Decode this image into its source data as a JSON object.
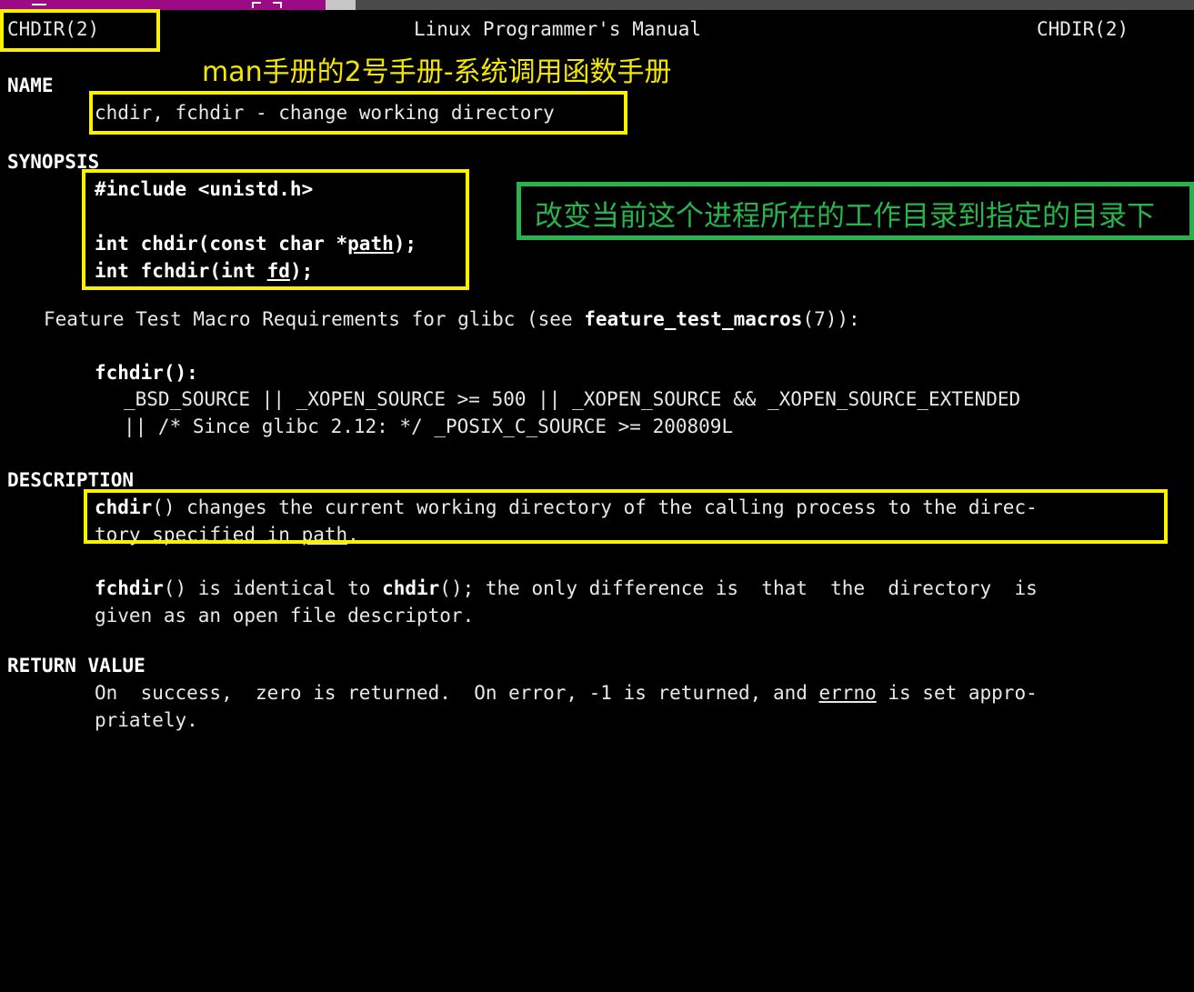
{
  "window": {
    "titlebar_magenta": "#9c0a86",
    "titlebar_dark": "#4a4a4a",
    "titlebar_tab": "#c6c6c6"
  },
  "annotation_colors": {
    "yellow": "#fbf000",
    "green": "#28b44c"
  },
  "manpage": {
    "header_left": "CHDIR(2)",
    "header_center": "Linux Programmer's Manual",
    "header_right": "CHDIR(2)",
    "sections": {
      "name_heading": "NAME",
      "name_body": "chdir, fchdir - change working directory",
      "synopsis_heading": "SYNOPSIS",
      "synopsis_include": "#include <unistd.h>",
      "synopsis_proto1_pre": "int chdir(const char *",
      "synopsis_proto1_arg": "path",
      "synopsis_proto1_post": ");",
      "synopsis_proto2_pre": "int fchdir(int ",
      "synopsis_proto2_arg": "fd",
      "synopsis_proto2_post": ");",
      "ftm_line_pre": "Feature Test Macro Requirements for glibc (see ",
      "ftm_line_bold": "feature_test_macros",
      "ftm_line_post": "(7)):",
      "ftm_func": "fchdir():",
      "ftm_req1": "_BSD_SOURCE || _XOPEN_SOURCE >= 500 || _XOPEN_SOURCE && _XOPEN_SOURCE_EXTENDED",
      "ftm_req2": "|| /* Since glibc 2.12: */ _POSIX_C_SOURCE >= 200809L",
      "description_heading": "DESCRIPTION",
      "desc_p1_bold": "chdir",
      "desc_p1_line1": "() changes the current working directory of the calling process to the direc-",
      "desc_p1_line2_pre": "tory specified in ",
      "desc_p1_line2_arg": "path",
      "desc_p1_line2_post": ".",
      "desc_p2_bold1": "fchdir",
      "desc_p2_mid": "() is identical to ",
      "desc_p2_bold2": "chdir",
      "desc_p2_line1_post": "(); the only difference is  that  the  directory  is",
      "desc_p2_line2": "given as an open file descriptor.",
      "return_heading": "RETURN VALUE",
      "ret_line1_pre": "On  success,  zero is returned.  On error, -1 is returned, and ",
      "ret_line1_arg": "errno",
      "ret_line1_post": " is set appro-",
      "ret_line2": "priately."
    }
  },
  "annotations": {
    "chinese_title": "man手册的2号手册-系统调用函数手册",
    "chinese_description": "改变当前这个进程所在的工作目录到指定的目录下",
    "boxes": [
      {
        "name": "highlight-box-header-chdir"
      },
      {
        "name": "highlight-box-name-body"
      },
      {
        "name": "highlight-box-synopsis"
      },
      {
        "name": "highlight-box-description"
      },
      {
        "name": "highlight-box-chinese-description"
      }
    ]
  }
}
